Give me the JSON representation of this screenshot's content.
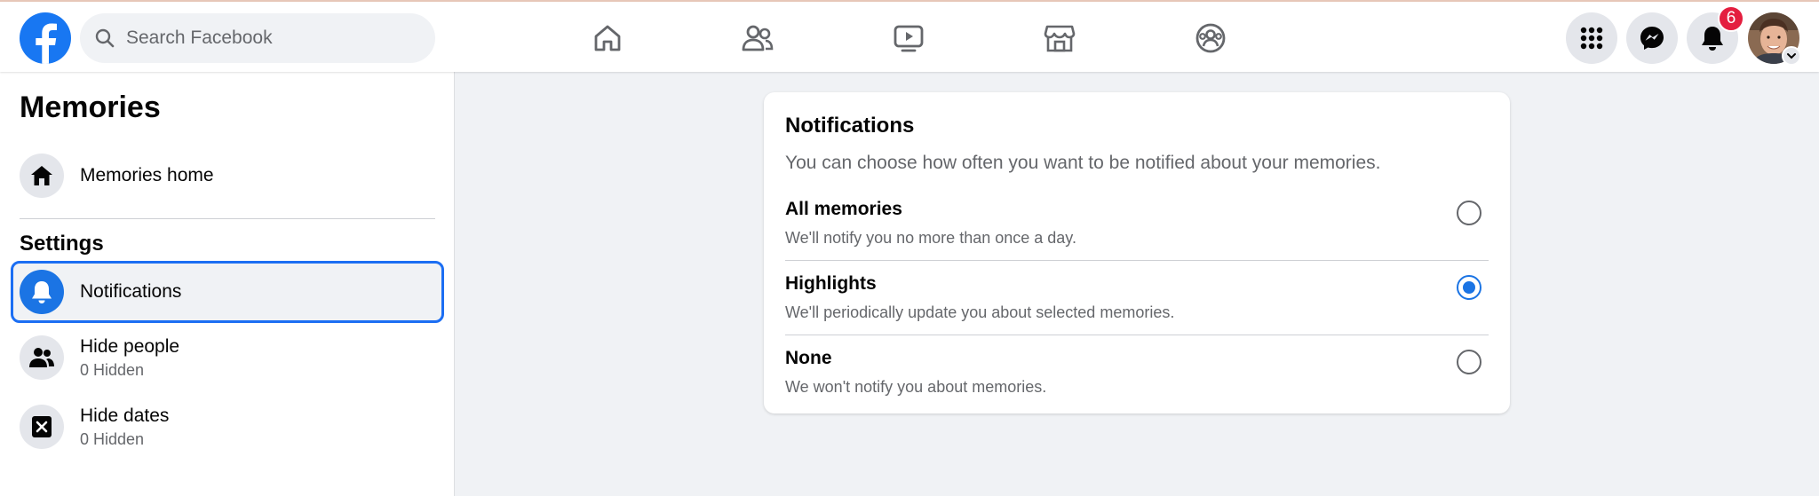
{
  "header": {
    "search_placeholder": "Search Facebook",
    "notification_count": "6",
    "nav": [
      "home-icon",
      "friends-icon",
      "watch-icon",
      "marketplace-icon",
      "groups-icon"
    ],
    "accent_color": "#1877f2"
  },
  "sidebar": {
    "title": "Memories",
    "home_label": "Memories home",
    "settings_title": "Settings",
    "items": [
      {
        "label": "Notifications",
        "sub": ""
      },
      {
        "label": "Hide people",
        "sub": "0 Hidden"
      },
      {
        "label": "Hide dates",
        "sub": "0 Hidden"
      }
    ]
  },
  "notifications": {
    "title": "Notifications",
    "description": "You can choose how often you want to be notified about your memories.",
    "options": [
      {
        "label": "All memories",
        "desc": "We'll notify you no more than once a day.",
        "selected": false
      },
      {
        "label": "Highlights",
        "desc": "We'll periodically update you about selected memories.",
        "selected": true
      },
      {
        "label": "None",
        "desc": "We won't notify you about memories.",
        "selected": false
      }
    ]
  }
}
